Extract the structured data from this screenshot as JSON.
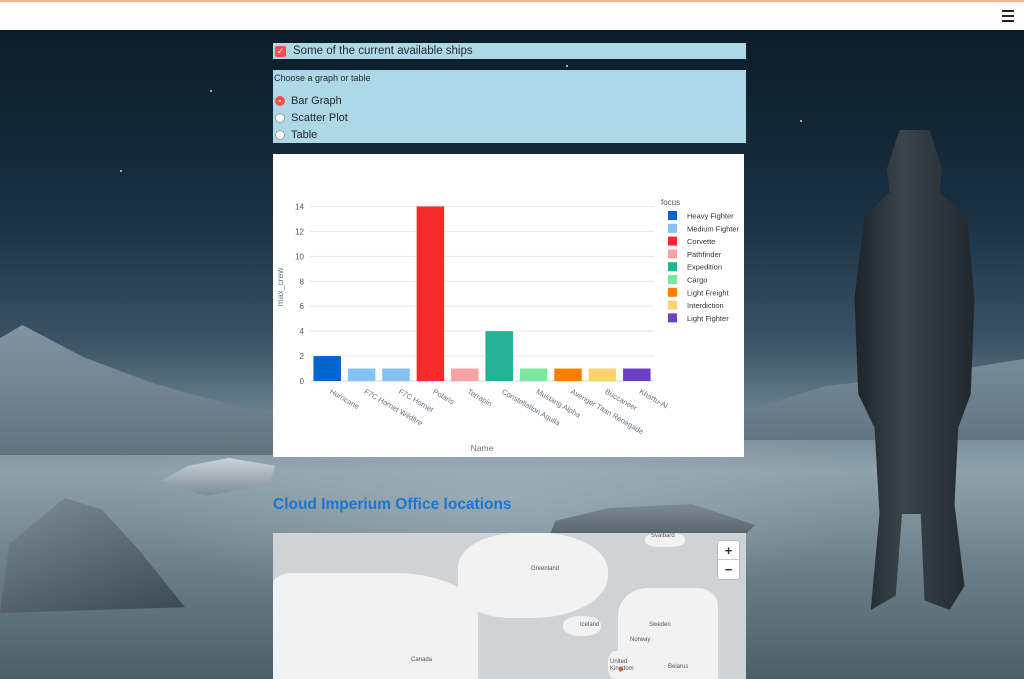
{
  "header": {
    "menu_icon": "hamburger-menu-icon"
  },
  "checkbox": {
    "label": "Some of the current available ships",
    "checked": true
  },
  "graph_selector": {
    "title": "Choose a graph or table",
    "options": [
      "Bar Graph",
      "Scatter Plot",
      "Table"
    ],
    "selected": "Bar Graph"
  },
  "chart_data": {
    "type": "bar",
    "categories": [
      "Hurricane",
      "F7C Hornet Wildfire",
      "F7C Hornet",
      "Polaris",
      "Terrapin",
      "Constellation Aquila",
      "Mustang Alpha",
      "Avenger Titan Renegade",
      "Buccaneer",
      "Khartu-Al"
    ],
    "values": [
      2,
      1,
      1,
      14,
      1,
      4,
      1,
      1,
      1,
      1
    ],
    "focus": [
      "Heavy Fighter",
      "Medium Fighter",
      "Medium Fighter",
      "Corvette",
      "Pathfinder",
      "Expedition",
      "Cargo",
      "Light Freight",
      "Interdiction",
      "Light Fighter"
    ],
    "xlabel": "Name",
    "ylabel": "max_crew",
    "ylim": [
      0,
      15
    ],
    "yticks": [
      0,
      2,
      4,
      6,
      8,
      10,
      12,
      14
    ],
    "grid": true,
    "legend_title": "focus",
    "legend_placement": "right",
    "legend": [
      {
        "name": "Heavy Fighter",
        "color": "#0066cc"
      },
      {
        "name": "Medium Fighter",
        "color": "#84c1f5"
      },
      {
        "name": "Corvette",
        "color": "#f52a2a"
      },
      {
        "name": "Pathfinder",
        "color": "#f7a3a6"
      },
      {
        "name": "Expedition",
        "color": "#24b294"
      },
      {
        "name": "Cargo",
        "color": "#7de6a1"
      },
      {
        "name": "Light Freight",
        "color": "#ff8000"
      },
      {
        "name": "Interdiction",
        "color": "#fcd370"
      },
      {
        "name": "Light Fighter",
        "color": "#6b3fc4"
      }
    ]
  },
  "section": {
    "title": "Cloud Imperium Office locations"
  },
  "map": {
    "labels": [
      "Svalbard",
      "Greenland",
      "Iceland",
      "Sweden",
      "Norway",
      "Canada",
      "United Kingdom",
      "Belarus"
    ],
    "zoom_in": "+",
    "zoom_out": "−"
  }
}
